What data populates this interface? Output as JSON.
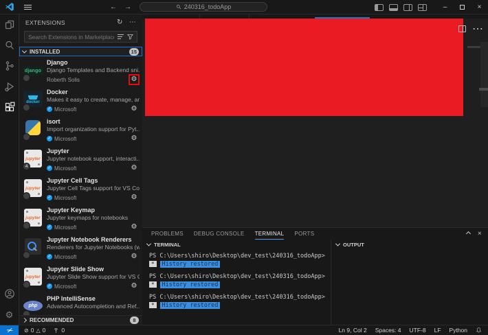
{
  "icons": {
    "refresh": "↻",
    "more": "⋯",
    "gear": "⚙",
    "check": "✓",
    "back": "←",
    "forward": "→",
    "minimize": "–",
    "close": "×",
    "error": "⊘",
    "warning": "△",
    "remote": "><"
  },
  "title_bar": {
    "search_value": "240316_todoApp"
  },
  "sidebar": {
    "title": "EXTENSIONS",
    "search_placeholder": "Search Extensions in Marketplace",
    "installed_label": "INSTALLED",
    "installed_count": "15",
    "recommended_label": "RECOMMENDED",
    "recommended_count": "8",
    "icon_labels": {
      "django": "django",
      "docker": "docker",
      "jupyter": "jupyter",
      "php": "php",
      "isort": "",
      "renderers": ""
    },
    "extensions": [
      {
        "name": "Django",
        "desc": "Django Templates and Backend sni...",
        "author": "Roberth Solis",
        "verified": false,
        "icon": "django",
        "annotated": true
      },
      {
        "name": "Docker",
        "desc": "Makes it easy to create, manage, an...",
        "author": "Microsoft",
        "verified": true,
        "icon": "docker"
      },
      {
        "name": "isort",
        "desc": "Import organization support for Pyt...",
        "author": "Microsoft",
        "verified": true,
        "icon": "isort"
      },
      {
        "name": "Jupyter",
        "desc": "Jupyter notebook support, interacti...",
        "author": "Microsoft",
        "verified": true,
        "icon": "jupyter",
        "pack_count": "4"
      },
      {
        "name": "Jupyter Cell Tags",
        "desc": "Jupyter Cell Tags support for VS Code",
        "author": "Microsoft",
        "verified": true,
        "icon": "jupyter"
      },
      {
        "name": "Jupyter Keymap",
        "desc": "Jupyter keymaps for notebooks",
        "author": "Microsoft",
        "verified": true,
        "icon": "jupyter"
      },
      {
        "name": "Jupyter Notebook Renderers",
        "desc": "Renderers for Jupyter Notebooks (w...",
        "author": "Microsoft",
        "verified": true,
        "icon": "renderers"
      },
      {
        "name": "Jupyter Slide Show",
        "desc": "Jupyter Slide Show support for VS C...",
        "author": "Microsoft",
        "verified": true,
        "icon": "jupyter"
      },
      {
        "name": "PHP IntelliSense",
        "desc": "Advanced Autocompletion and Ref...",
        "author": "",
        "verified": false,
        "icon": "php",
        "footer": false
      }
    ]
  },
  "panel": {
    "tabs": [
      {
        "label": "PROBLEMS",
        "active": false
      },
      {
        "label": "DEBUG CONSOLE",
        "active": false
      },
      {
        "label": "TERMINAL",
        "active": true
      },
      {
        "label": "PORTS",
        "active": false
      }
    ],
    "terminal_section_label": "TERMINAL",
    "output_section_label": "OUTPUT",
    "terminal_groups": [
      {
        "prompt": "PS C:\\Users\\shiro\\Desktop\\dev_test\\240316_todoApp>",
        "marker": "*",
        "notice": "History restored"
      },
      {
        "prompt": "PS C:\\Users\\shiro\\Desktop\\dev_test\\240316_todoApp>",
        "marker": "*",
        "notice": "History restored"
      },
      {
        "prompt": "PS C:\\Users\\shiro\\Desktop\\dev_test\\240316_todoApp>",
        "marker": "*",
        "notice": "History restored"
      }
    ]
  },
  "status_bar": {
    "errors": "0",
    "warnings": "0",
    "ports": "0",
    "line_col": "Ln 9, Col 2",
    "indent": "Spaces: 4",
    "encoding": "UTF-8",
    "eol": "LF",
    "language": "Python"
  }
}
